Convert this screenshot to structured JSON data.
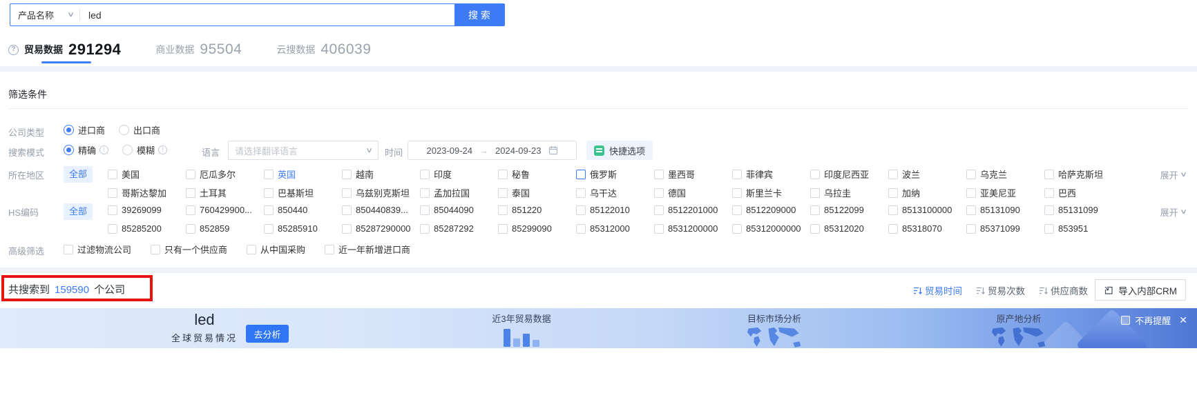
{
  "search": {
    "category": "产品名称",
    "query": "led",
    "button": "搜 索"
  },
  "icons": {
    "chevron_down": "∨",
    "arrow_right": "→",
    "close": "✕",
    "help": "?",
    "info": "!"
  },
  "tabs": [
    {
      "label": "贸易数据",
      "count": "291294",
      "active": true
    },
    {
      "label": "商业数据",
      "count": "95504",
      "active": false
    },
    {
      "label": "云搜数据",
      "count": "406039",
      "active": false
    }
  ],
  "filter": {
    "title": "筛选条件",
    "company_type": {
      "label": "公司类型",
      "options": [
        {
          "t": "进口商",
          "checked": true
        },
        {
          "t": "出口商",
          "checked": false
        }
      ]
    },
    "search_mode": {
      "label": "搜索模式",
      "options": [
        {
          "t": "精确",
          "checked": true
        },
        {
          "t": "模糊",
          "checked": false
        }
      ],
      "language_label": "语言",
      "language_placeholder": "请选择翻译语言",
      "time_label": "时间",
      "date_start": "2023-09-24",
      "date_end": "2024-09-23",
      "quick_option": "快捷选项"
    },
    "region": {
      "label": "所在地区",
      "all": "全部",
      "expand": "展开",
      "rows": [
        [
          {
            "t": "美国"
          },
          {
            "t": "厄瓜多尔"
          },
          {
            "t": "英国",
            "blue_text": true
          },
          {
            "t": "越南"
          },
          {
            "t": "印度"
          },
          {
            "t": "秘鲁"
          },
          {
            "t": "俄罗斯",
            "blue_box": true
          },
          {
            "t": "墨西哥"
          },
          {
            "t": "菲律宾"
          },
          {
            "t": "印度尼西亚"
          },
          {
            "t": "波兰"
          },
          {
            "t": "乌克兰"
          },
          {
            "t": "哈萨克斯坦"
          }
        ],
        [
          {
            "t": "哥斯达黎加"
          },
          {
            "t": "土耳其"
          },
          {
            "t": "巴基斯坦"
          },
          {
            "t": "乌兹别克斯坦"
          },
          {
            "t": "孟加拉国"
          },
          {
            "t": "泰国"
          },
          {
            "t": "乌干达"
          },
          {
            "t": "德国"
          },
          {
            "t": "斯里兰卡"
          },
          {
            "t": "乌拉圭"
          },
          {
            "t": "加纳"
          },
          {
            "t": "亚美尼亚"
          },
          {
            "t": "巴西"
          }
        ]
      ]
    },
    "hs_code": {
      "label": "HS编码",
      "all": "全部",
      "expand": "展开",
      "rows": [
        [
          {
            "t": "39269099"
          },
          {
            "t": "760429900..."
          },
          {
            "t": "850440"
          },
          {
            "t": "850440839..."
          },
          {
            "t": "85044090"
          },
          {
            "t": "851220"
          },
          {
            "t": "85122010"
          },
          {
            "t": "8512201000"
          },
          {
            "t": "8512209000"
          },
          {
            "t": "85122099"
          },
          {
            "t": "8513100000"
          },
          {
            "t": "85131090"
          },
          {
            "t": "85131099"
          }
        ],
        [
          {
            "t": "85285200"
          },
          {
            "t": "852859"
          },
          {
            "t": "85285910"
          },
          {
            "t": "85287290000"
          },
          {
            "t": "85287292"
          },
          {
            "t": "85299090"
          },
          {
            "t": "85312000"
          },
          {
            "t": "8531200000"
          },
          {
            "t": "85312000000"
          },
          {
            "t": "85312020"
          },
          {
            "t": "85318070"
          },
          {
            "t": "85371099"
          },
          {
            "t": "853951"
          }
        ]
      ]
    },
    "advanced": {
      "label": "高级筛选",
      "options": [
        "过滤物流公司",
        "只有一个供应商",
        "从中国采购",
        "近一年新增进口商"
      ]
    }
  },
  "results": {
    "prefix": "共搜索到",
    "count": "159590",
    "suffix": "个公司",
    "sorts": [
      {
        "label": "贸易时间",
        "active": true
      },
      {
        "label": "贸易次数",
        "active": false
      },
      {
        "label": "供应商数",
        "active": false
      }
    ],
    "crm_button": "导入内部CRM"
  },
  "banner": {
    "keyword": "led",
    "subtitle": "全球贸易情况",
    "analyze_button": "去分析",
    "cards": [
      "近3年贸易数据",
      "目标市场分析",
      "原产地分析"
    ],
    "dismiss": "不再提醒"
  },
  "colors": {
    "accent": "#3d7bf7",
    "annotation_red": "#e8140f",
    "chip_bg": "#e8f1ff",
    "quick_icon_green": "#3ec28f",
    "banner_gradient_from": "#dfeafb",
    "banner_gradient_to": "#4e77d4"
  }
}
